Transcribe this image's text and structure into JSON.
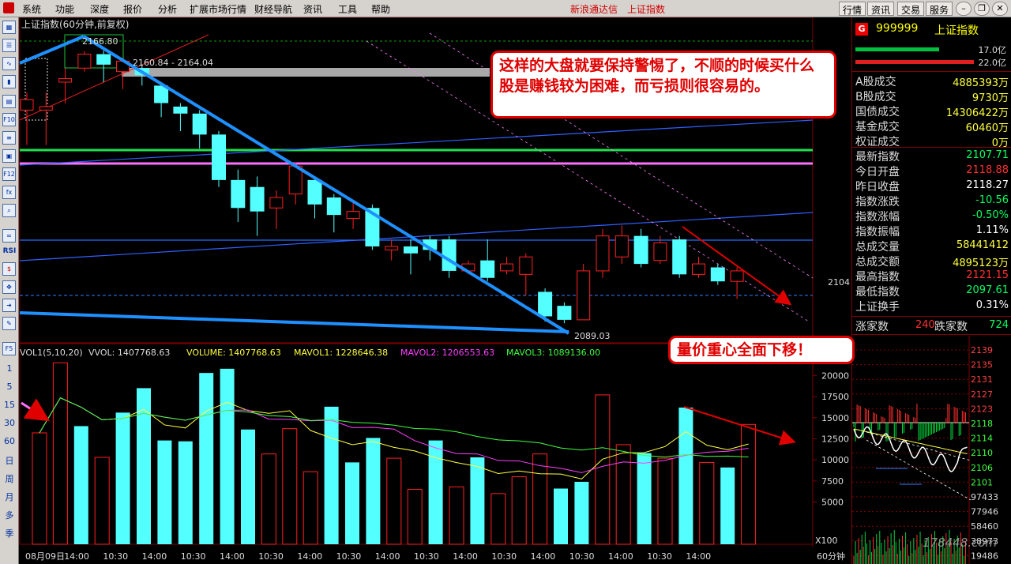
{
  "menu": {
    "items": [
      "系统",
      "功能",
      "深度",
      "报价",
      "分析",
      "扩展市场行情",
      "财经导航",
      "资讯",
      "工具",
      "帮助"
    ],
    "broker": "新浪通达信",
    "index_name": "上证指数",
    "right_buttons": [
      "行情",
      "资讯",
      "交易",
      "服务"
    ]
  },
  "left_toolbar": {
    "rsi_label": "RSI",
    "periods": [
      "1",
      "5",
      "15",
      "30",
      "60",
      "日",
      "周",
      "月",
      "多",
      "季"
    ]
  },
  "main_chart": {
    "title": "上证指数(60分钟,前复权)",
    "top_price_label": "2166.80",
    "gap_label": "2160.84 - 2164.04",
    "low_label": "2089.03",
    "right_price_label": "2104"
  },
  "volume_panel": {
    "indicator": "VOL1(5,10,20)",
    "vvol": "VVOL: 1407768.63",
    "volume": "VOLUME: 1407768.63",
    "mavol1": "MAVOL1: 1228646.38",
    "mavol2": "MAVOL2: 1206553.63",
    "mavol3": "MAVOL3: 1089136.00",
    "yticks": [
      "20000",
      "17500",
      "15000",
      "12500",
      "10000",
      "7500",
      "5000"
    ],
    "unit": "X100"
  },
  "xaxis": {
    "labels": [
      "08月09日",
      "14:00",
      "10:30",
      "14:00",
      "10:30",
      "14:00",
      "10:30",
      "14:00",
      "10:30",
      "14:00",
      "10:30",
      "14:00",
      "10:30",
      "14:00",
      "10:30",
      "14:00",
      "10:30",
      "14:00"
    ],
    "period": "60分钟"
  },
  "colors": {
    "up": "#ff2020",
    "down": "#54ffff",
    "bg": "#000000",
    "callout_red": "#e00000"
  },
  "chart_data": {
    "type": "candlestick",
    "title": "上证指数(60分钟,前复权)",
    "candles": [
      {
        "o": 2150,
        "c": 2153,
        "h": 2155,
        "l": 2140,
        "dir": "up"
      },
      {
        "o": 2150,
        "c": 2151,
        "h": 2155,
        "l": 2140,
        "dir": "up"
      },
      {
        "o": 2158,
        "c": 2159,
        "h": 2162,
        "l": 2152,
        "dir": "up"
      },
      {
        "o": 2162,
        "c": 2166,
        "h": 2166.8,
        "l": 2161,
        "dir": "up"
      },
      {
        "o": 2166,
        "c": 2163,
        "h": 2167,
        "l": 2158,
        "dir": "down"
      },
      {
        "o": 2164,
        "c": 2161,
        "h": 2165,
        "l": 2156,
        "dir": "up"
      },
      {
        "o": 2162,
        "c": 2160,
        "h": 2163,
        "l": 2157,
        "dir": "down"
      },
      {
        "o": 2157,
        "c": 2152,
        "h": 2158,
        "l": 2148,
        "dir": "down"
      },
      {
        "o": 2151,
        "c": 2149,
        "h": 2152,
        "l": 2144,
        "dir": "down"
      },
      {
        "o": 2149,
        "c": 2143,
        "h": 2150,
        "l": 2139,
        "dir": "down"
      },
      {
        "o": 2143,
        "c": 2130,
        "h": 2144,
        "l": 2128,
        "dir": "down"
      },
      {
        "o": 2130,
        "c": 2122,
        "h": 2133,
        "l": 2118,
        "dir": "down"
      },
      {
        "o": 2128,
        "c": 2121,
        "h": 2131,
        "l": 2114,
        "dir": "down"
      },
      {
        "o": 2122,
        "c": 2125,
        "h": 2127,
        "l": 2116,
        "dir": "up"
      },
      {
        "o": 2126,
        "c": 2134,
        "h": 2135,
        "l": 2123,
        "dir": "up"
      },
      {
        "o": 2130,
        "c": 2123,
        "h": 2131,
        "l": 2119,
        "dir": "down"
      },
      {
        "o": 2125,
        "c": 2120,
        "h": 2126,
        "l": 2115,
        "dir": "down"
      },
      {
        "o": 2119,
        "c": 2121,
        "h": 2124,
        "l": 2116,
        "dir": "up"
      },
      {
        "o": 2122,
        "c": 2111,
        "h": 2123,
        "l": 2110,
        "dir": "down"
      },
      {
        "o": 2111,
        "c": 2110,
        "h": 2113,
        "l": 2107,
        "dir": "up"
      },
      {
        "o": 2111,
        "c": 2109,
        "h": 2113,
        "l": 2103,
        "dir": "down"
      },
      {
        "o": 2113,
        "c": 2110,
        "h": 2114,
        "l": 2107,
        "dir": "down"
      },
      {
        "o": 2113,
        "c": 2104,
        "h": 2114,
        "l": 2102,
        "dir": "down"
      },
      {
        "o": 2104,
        "c": 2106,
        "h": 2107,
        "l": 2103,
        "dir": "up"
      },
      {
        "o": 2107,
        "c": 2102,
        "h": 2113,
        "l": 2101,
        "dir": "down"
      },
      {
        "o": 2104,
        "c": 2106,
        "h": 2108,
        "l": 2103,
        "dir": "up"
      },
      {
        "o": 2103,
        "c": 2108,
        "h": 2109,
        "l": 2097,
        "dir": "up"
      },
      {
        "o": 2098,
        "c": 2091,
        "h": 2099,
        "l": 2089.5,
        "dir": "down"
      },
      {
        "o": 2094,
        "c": 2090,
        "h": 2095,
        "l": 2089.03,
        "dir": "down"
      },
      {
        "o": 2090,
        "c": 2104,
        "h": 2106,
        "l": 2090,
        "dir": "up"
      },
      {
        "o": 2104,
        "c": 2114,
        "h": 2116,
        "l": 2102,
        "dir": "up"
      },
      {
        "o": 2108,
        "c": 2114,
        "h": 2117,
        "l": 2106,
        "dir": "up"
      },
      {
        "o": 2114,
        "c": 2106,
        "h": 2116,
        "l": 2105,
        "dir": "down"
      },
      {
        "o": 2107,
        "c": 2112,
        "h": 2114,
        "l": 2106,
        "dir": "up"
      },
      {
        "o": 2113,
        "c": 2103,
        "h": 2114,
        "l": 2102,
        "dir": "down"
      },
      {
        "o": 2103,
        "c": 2106,
        "h": 2108,
        "l": 2102,
        "dir": "up"
      },
      {
        "o": 2105,
        "c": 2101,
        "h": 2106,
        "l": 2100,
        "dir": "down"
      },
      {
        "o": 2101,
        "c": 2104,
        "h": 2105,
        "l": 2096,
        "dir": "up"
      }
    ],
    "volumes": [
      {
        "v": 13200,
        "dir": "up"
      },
      {
        "v": 21500,
        "dir": "up"
      },
      {
        "v": 14000,
        "dir": "down"
      },
      {
        "v": 10300,
        "dir": "up"
      },
      {
        "v": 15600,
        "dir": "down"
      },
      {
        "v": 18500,
        "dir": "down"
      },
      {
        "v": 12300,
        "dir": "down"
      },
      {
        "v": 12200,
        "dir": "down"
      },
      {
        "v": 20300,
        "dir": "down"
      },
      {
        "v": 20800,
        "dir": "down"
      },
      {
        "v": 13600,
        "dir": "down"
      },
      {
        "v": 10700,
        "dir": "up"
      },
      {
        "v": 13700,
        "dir": "up"
      },
      {
        "v": 8600,
        "dir": "up"
      },
      {
        "v": 16300,
        "dir": "down"
      },
      {
        "v": 9700,
        "dir": "down"
      },
      {
        "v": 12600,
        "dir": "down"
      },
      {
        "v": 10200,
        "dir": "up"
      },
      {
        "v": 6500,
        "dir": "up"
      },
      {
        "v": 12300,
        "dir": "down"
      },
      {
        "v": 6800,
        "dir": "up"
      },
      {
        "v": 10300,
        "dir": "down"
      },
      {
        "v": 6000,
        "dir": "up"
      },
      {
        "v": 8000,
        "dir": "up"
      },
      {
        "v": 10700,
        "dir": "up"
      },
      {
        "v": 6600,
        "dir": "down"
      },
      {
        "v": 7400,
        "dir": "down"
      },
      {
        "v": 17700,
        "dir": "up"
      },
      {
        "v": 11800,
        "dir": "up"
      },
      {
        "v": 10800,
        "dir": "down"
      },
      {
        "v": 10200,
        "dir": "up"
      },
      {
        "v": 16200,
        "dir": "down"
      },
      {
        "v": 9700,
        "dir": "up"
      },
      {
        "v": 9100,
        "dir": "down"
      },
      {
        "v": 14200,
        "dir": "up"
      }
    ],
    "ylim": [
      2085,
      2172
    ],
    "vol_ylim": [
      0,
      22000
    ]
  },
  "quote": {
    "code": "999999",
    "name": "上证指数",
    "g_label": "G",
    "bar1": "17.0亿",
    "bar2": "22.0亿",
    "rows": [
      {
        "k": "A股成交",
        "v": "4885393万",
        "c": "yel"
      },
      {
        "k": "B股成交",
        "v": "9730万",
        "c": "yel"
      },
      {
        "k": "国债成交",
        "v": "14306422万",
        "c": "yel"
      },
      {
        "k": "基金成交",
        "v": "60460万",
        "c": "yel"
      },
      {
        "k": "权证成交",
        "v": "0万",
        "c": "yel"
      },
      {
        "k": "最新指数",
        "v": "2107.71",
        "c": "grn"
      },
      {
        "k": "今日开盘",
        "v": "2118.88",
        "c": "red2"
      },
      {
        "k": "昨日收盘",
        "v": "2118.27",
        "c": "wht"
      },
      {
        "k": "指数涨跌",
        "v": "-10.56",
        "c": "grn"
      },
      {
        "k": "指数涨幅",
        "v": "-0.50%",
        "c": "grn"
      },
      {
        "k": "指数振幅",
        "v": "1.11%",
        "c": "wht"
      },
      {
        "k": "总成交量",
        "v": "58441412",
        "c": "yel"
      },
      {
        "k": "总成交额",
        "v": "4895123万",
        "c": "yel"
      },
      {
        "k": "最高指数",
        "v": "2121.15",
        "c": "red2"
      },
      {
        "k": "最低指数",
        "v": "2097.61",
        "c": "grn"
      },
      {
        "k": "上证换手",
        "v": "0.31%",
        "c": "wht"
      }
    ],
    "rise_label": "涨家数",
    "rise_value": "240",
    "fall_label": "跌家数",
    "fall_value": "724"
  },
  "minichart": {
    "yticks": [
      "2139",
      "2135",
      "2131",
      "2127",
      "2123",
      "2118",
      "2114",
      "2110",
      "2106",
      "2101",
      "97433",
      "77946",
      "58460",
      "38973",
      "19486"
    ]
  },
  "annotations": {
    "callout1": "这样的大盘就要保持警惕了，不顺的时候买什么股是赚钱较为困难，而亏损则很容易的。",
    "callout2": "量价重心全面下移！"
  },
  "watermark": "178448.com"
}
